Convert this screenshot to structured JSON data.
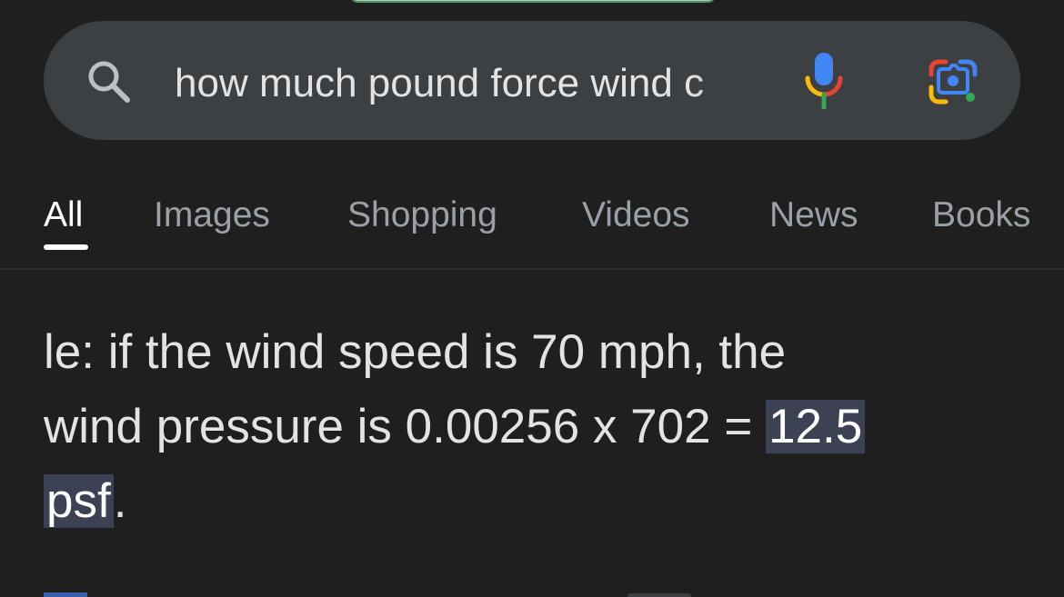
{
  "search": {
    "query": "how much pound force wind c"
  },
  "tabs": [
    {
      "label": "All",
      "active": true
    },
    {
      "label": "Images",
      "active": false
    },
    {
      "label": "Shopping",
      "active": false
    },
    {
      "label": "Videos",
      "active": false
    },
    {
      "label": "News",
      "active": false
    },
    {
      "label": "Books",
      "active": false
    }
  ],
  "snippet": {
    "line1": "le: if the wind speed is 70 mph, the",
    "line2_prefix": "wind pressure is 0.00256 x 702 = ",
    "highlight_part1": "12.5",
    "highlight_part2": "psf",
    "suffix": "."
  },
  "icons": {
    "search": "search-icon",
    "microphone": "microphone-icon",
    "lens": "google-lens-icon"
  },
  "colors": {
    "background": "#1f1f1f",
    "search_bar": "#3c4043",
    "tab_inactive": "#9aa0a6",
    "tab_active": "#ffffff",
    "highlight": "#3c4153",
    "google_blue": "#4285f4",
    "google_red": "#ea4335",
    "google_yellow": "#fbbc04",
    "google_green": "#34a853"
  }
}
